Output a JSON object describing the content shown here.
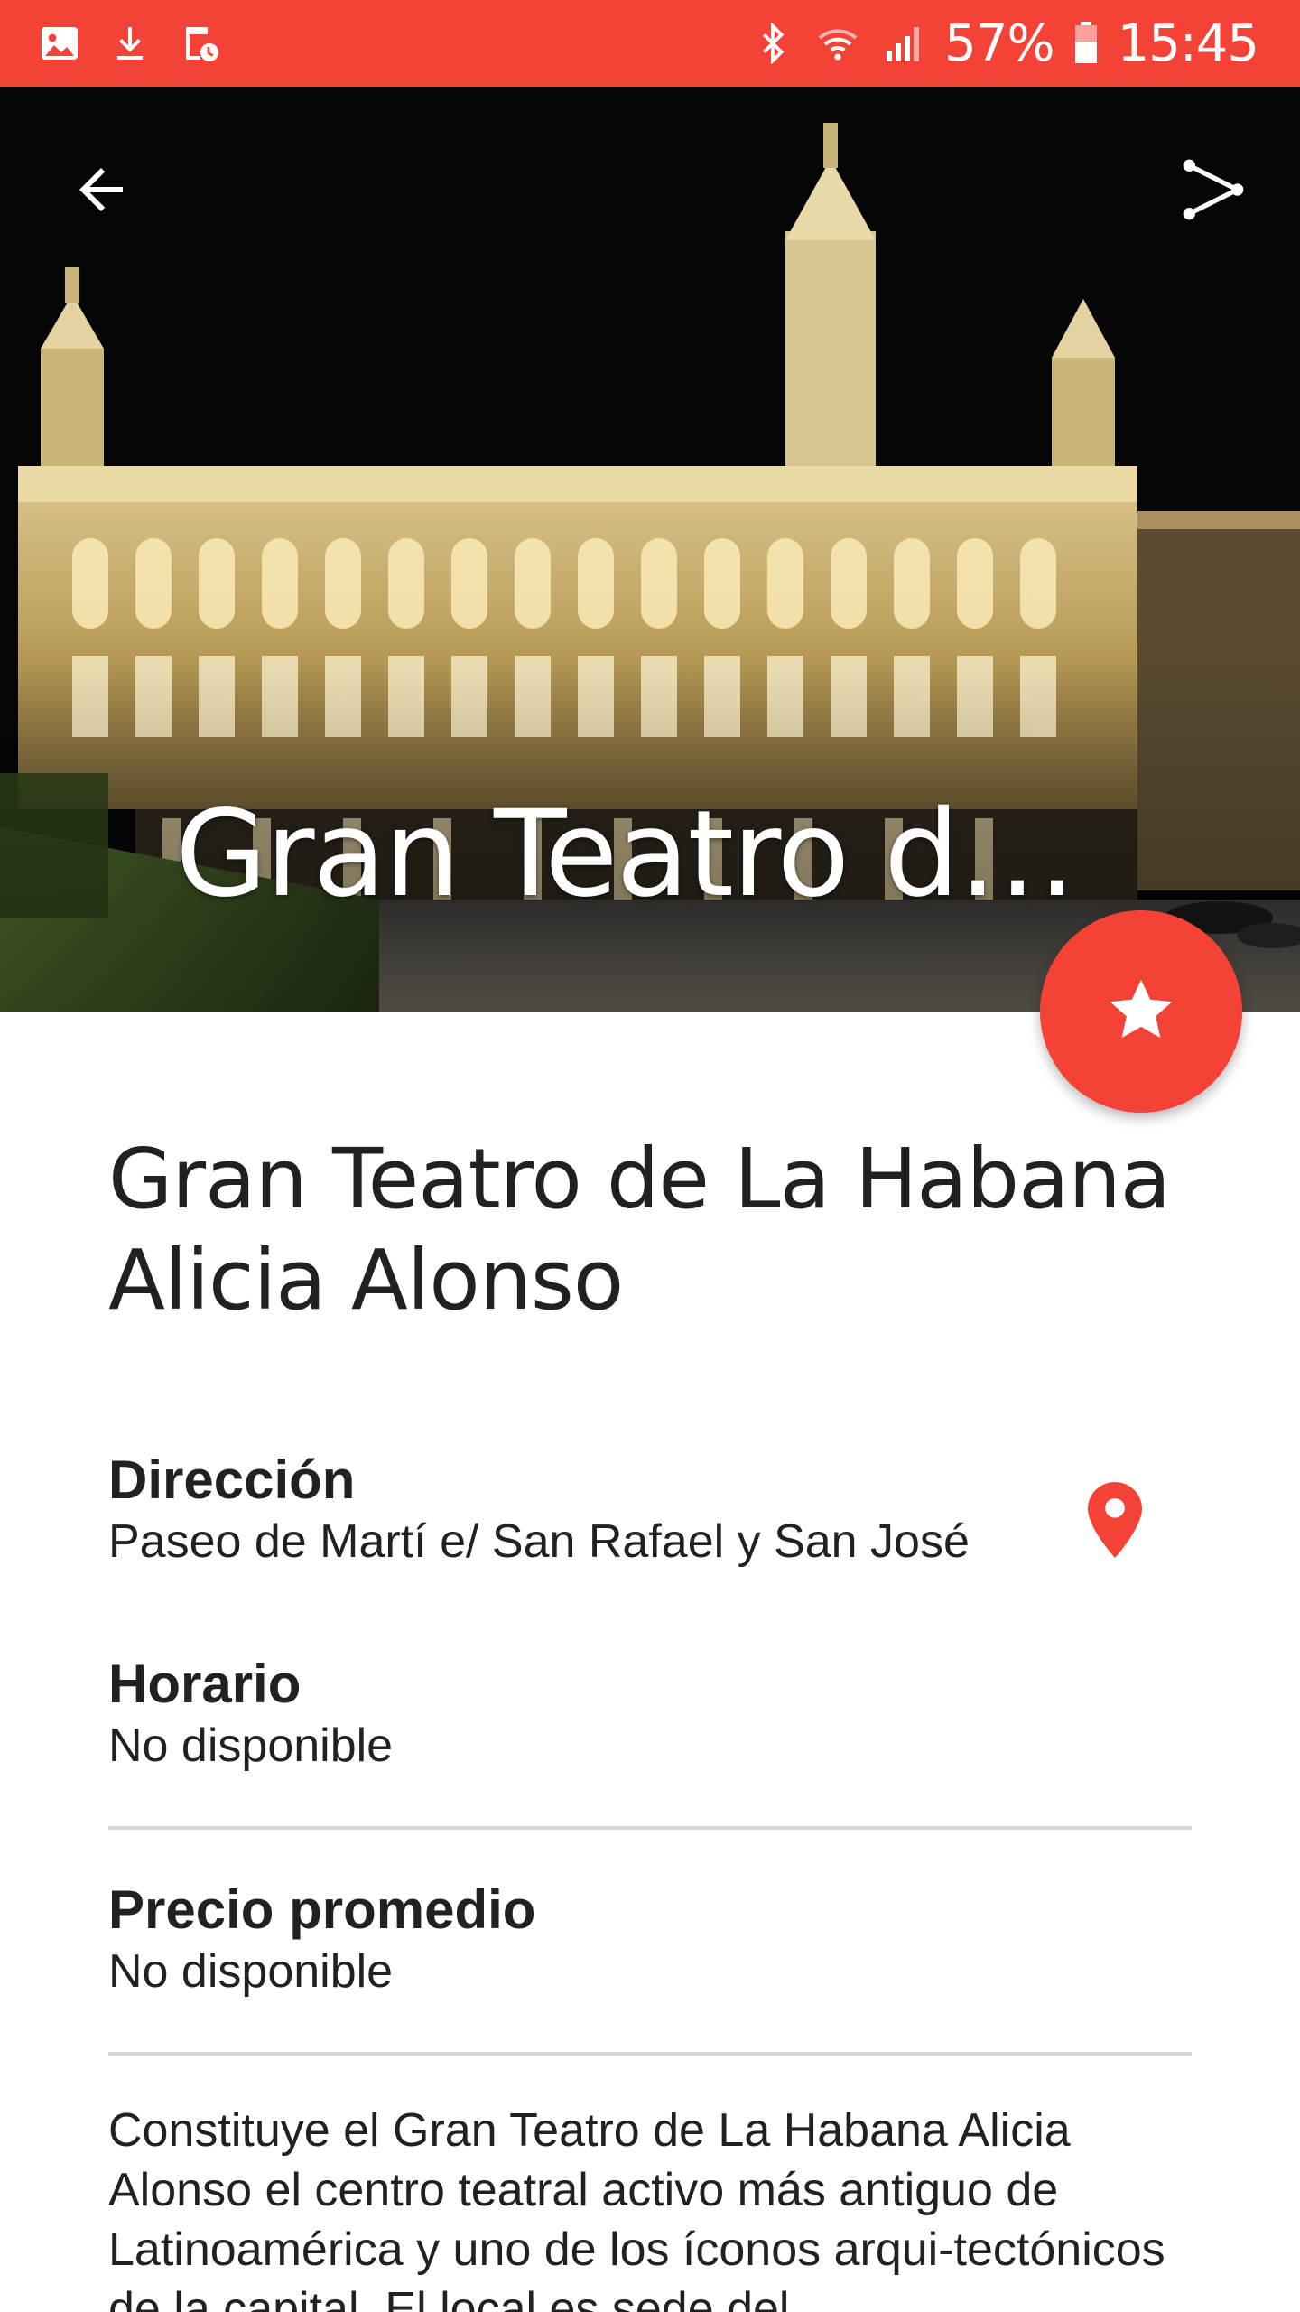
{
  "status_bar": {
    "battery": "57%",
    "time": "15:45",
    "left_icons": [
      "image-icon",
      "download-icon",
      "calendar-clock-icon"
    ],
    "right_icons": [
      "bluetooth-icon",
      "wifi-icon",
      "cellular-signal-icon",
      "battery-icon"
    ],
    "color": "#f44336"
  },
  "toolbar": {
    "back_icon": "arrow-left-icon",
    "share_icon": "share-icon"
  },
  "hero": {
    "title": "Gran Teatro de La Habana Alicia Alonso"
  },
  "fab": {
    "icon": "star-icon",
    "color": "#f44336"
  },
  "place": {
    "title": "Gran Teatro de La Habana Alicia Alonso",
    "address_label": "Dirección",
    "address_value": "Paseo de Martí e/ San Rafael y San José",
    "address_icon": "map-pin-icon",
    "hours_label": "Horario",
    "hours_value": "No disponible",
    "price_label": "Precio promedio",
    "price_value": "No disponible",
    "description": "Constituye el Gran Teatro de La Habana Alicia Alonso el centro teatral activo más antiguo de Latinoamérica y uno de los íconos arqui-tectónicos de la capital. El local es sede del"
  },
  "colors": {
    "accent": "#f44336",
    "text": "#212121",
    "divider": "#d6d6d6"
  }
}
